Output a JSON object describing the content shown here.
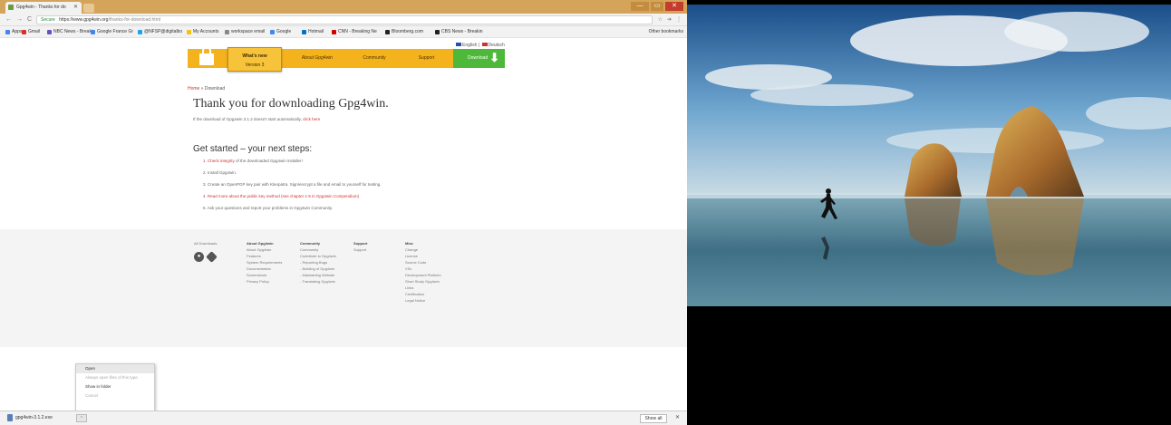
{
  "browser": {
    "tab_title": "Gpg4win - Thanks for do",
    "tab_close": "✕",
    "window_min": "—",
    "window_max": "▭",
    "window_close": "✕",
    "nav_back": "←",
    "nav_forward": "→",
    "nav_reload": "C",
    "secure_label": "Secure",
    "url_host": "https://www.gpg4win.org",
    "url_path": "/thanks-for-download.html",
    "omni_star": "☆",
    "omni_ext": "➔",
    "omni_menu": "⋮",
    "bookmarks": [
      {
        "label": "Apps",
        "color": "#4285f4"
      },
      {
        "label": "Gmail",
        "color": "#d93025"
      },
      {
        "label": "NBC News - Breakin",
        "color": "#6b4fbb"
      },
      {
        "label": "Google France Gr",
        "color": "#4285f4"
      },
      {
        "label": "@NFSP@digitalbo",
        "color": "#1da1f2"
      },
      {
        "label": "My Accounts",
        "color": "#f4c20d"
      },
      {
        "label": "workspace email",
        "color": "#888888"
      },
      {
        "label": "Google",
        "color": "#4285f4"
      },
      {
        "label": "Hotmail",
        "color": "#0072c6"
      },
      {
        "label": "CNN - Breaking Ne",
        "color": "#cc0000"
      },
      {
        "label": "Bloomberg.com",
        "color": "#222222"
      },
      {
        "label": "CBS News - Breakin",
        "color": "#222222"
      }
    ],
    "other_bookmarks": "Other bookmarks"
  },
  "page": {
    "lang": {
      "english": "English",
      "deutsch": "Deutsch",
      "sep": "|"
    },
    "whats_new_title": "What's new",
    "whats_new_version": "Version 3",
    "nav": {
      "about": "About Gpg4win",
      "community": "Community",
      "support": "Support",
      "download": "Download",
      "download_arrow": "⬇"
    },
    "breadcrumb": {
      "home": "Home",
      "sep": " » ",
      "current": "Download"
    },
    "heading": "Thank you for downloading Gpg4win.",
    "subline_text": "If the download of Gpg4win 3.1.2 doesn't start automatically,",
    "subline_link": "click here",
    "next_steps_heading": "Get started – your next steps:",
    "steps": [
      {
        "link": "1. Check integrity",
        "text": " of the downloaded Gpg4win installer!"
      },
      {
        "link": "",
        "text": "2. Install Gpg4win."
      },
      {
        "link": "",
        "text": "3. Create an OpenPGP key pair with Kleopatra. Sign/encrypt a file and email to yourself for testing."
      },
      {
        "link": "4. Read more about the public key method (see chapter 1-5 in Gpg4win Compendium)",
        "text": ""
      },
      {
        "link": "",
        "text": "5. Ask your questions and report your problems in Gpg4win Community."
      }
    ]
  },
  "footer": {
    "all_downloads": "All Downloads",
    "about_head": "About Gpg4win",
    "about_items": [
      "About Gpg4win",
      "Features",
      "System Requirements",
      "Documentation",
      "Screenshots",
      "Privacy Policy"
    ],
    "community_head": "Community",
    "community_items": [
      "Community",
      "Contribute to Gpg4win",
      "- Reporting Bugs",
      "- Building of Gpg4win",
      "- Maintaining Website",
      "- Translating Gpg4win"
    ],
    "support_head": "Support",
    "support_items": [
      "Support"
    ],
    "misc_head": "Misc",
    "misc_items": [
      "Change",
      "License",
      "Source Code",
      "VSx",
      "Development Platform",
      "Short Study Gpg4win",
      "Links",
      "Certification",
      "Legal Notice"
    ]
  },
  "context_menu": {
    "items": [
      {
        "label": "Open",
        "disabled": false
      },
      {
        "label": "Always open files of this type",
        "disabled": true
      },
      {
        "label": "Show in folder",
        "disabled": false
      },
      {
        "label": "Cancel",
        "disabled": true
      }
    ]
  },
  "download_shelf": {
    "filename": "gpg4win-3.1.2.exe",
    "caret": "⌃",
    "show_all": "Show all",
    "close": "✕"
  }
}
